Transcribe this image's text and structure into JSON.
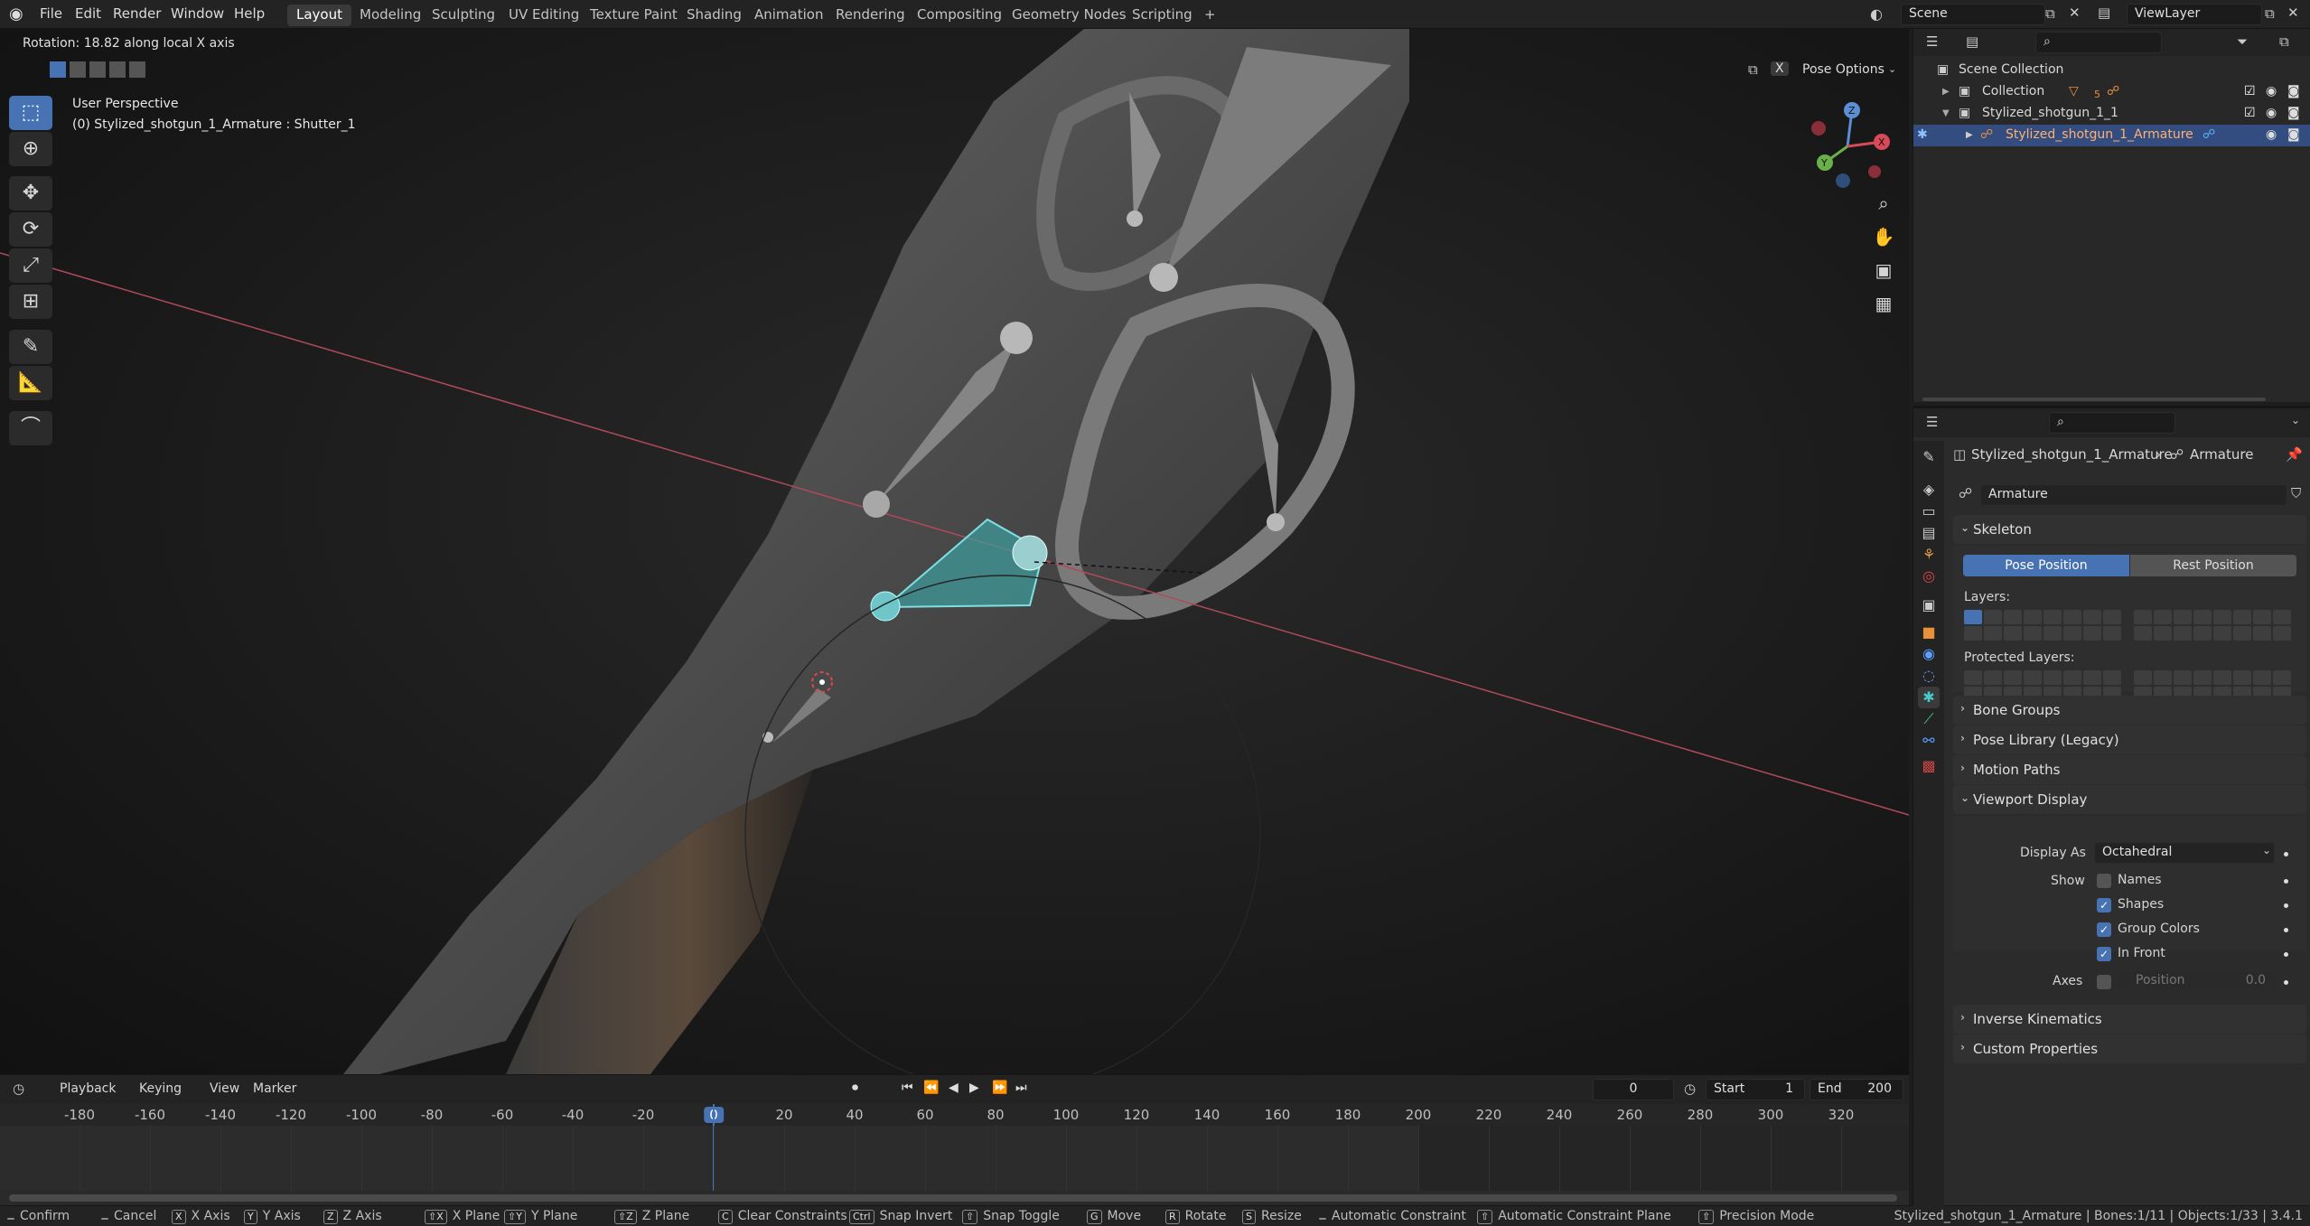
{
  "topbar": {
    "menus": [
      "File",
      "Edit",
      "Render",
      "Window",
      "Help"
    ],
    "workspaces": [
      "Layout",
      "Modeling",
      "Sculpting",
      "UV Editing",
      "Texture Paint",
      "Shading",
      "Animation",
      "Rendering",
      "Compositing",
      "Geometry Nodes",
      "Scripting"
    ],
    "add_tab": "+",
    "scene": "Scene",
    "view_layer": "ViewLayer"
  },
  "viewport": {
    "header_status": "Rotation: 18.82 along local X axis",
    "perspective": "User Perspective",
    "object_info": "(0) Stylized_shotgun_1_Armature : Shutter_1",
    "pose_options": "Pose Options",
    "x_toggle": "X",
    "gizmo": {
      "x": "X",
      "y": "Y",
      "z": "Z"
    }
  },
  "tools": [
    "select-icon",
    "cursor-icon",
    "move-icon",
    "rotate-icon",
    "scale-icon",
    "transform-icon",
    "annotate-icon",
    "measure-icon",
    "bone-envelope-icon"
  ],
  "timeline": {
    "menus": [
      "Playback",
      "Keying",
      "View",
      "Marker"
    ],
    "current_frame": "0",
    "start_label": "Start",
    "start": "1",
    "end_label": "End",
    "end": "200",
    "ticks": [
      "-180",
      "-160",
      "-140",
      "-120",
      "-100",
      "-80",
      "-60",
      "-40",
      "-20",
      "0",
      "20",
      "40",
      "60",
      "80",
      "100",
      "120",
      "140",
      "160",
      "180",
      "200",
      "220",
      "240",
      "260",
      "280",
      "300",
      "320"
    ]
  },
  "status": {
    "items": [
      {
        "k": "",
        "t": "Confirm"
      },
      {
        "k": "",
        "t": "Cancel"
      },
      {
        "k": "X",
        "t": "X Axis"
      },
      {
        "k": "Y",
        "t": "Y Axis"
      },
      {
        "k": "Z",
        "t": "Z Axis"
      },
      {
        "k": "⇧X",
        "t": "X Plane"
      },
      {
        "k": "⇧Y",
        "t": "Y Plane"
      },
      {
        "k": "⇧Z",
        "t": "Z Plane"
      },
      {
        "k": "C",
        "t": "Clear Constraints"
      },
      {
        "k": "Ctrl",
        "t": "Snap Invert"
      },
      {
        "k": "⇧",
        "t": "Snap Toggle"
      },
      {
        "k": "G",
        "t": "Move"
      },
      {
        "k": "R",
        "t": "Rotate"
      },
      {
        "k": "S",
        "t": "Resize"
      },
      {
        "k": "",
        "t": "Automatic Constraint"
      },
      {
        "k": "⇧",
        "t": "Automatic Constraint Plane"
      },
      {
        "k": "⇧",
        "t": "Precision Mode"
      }
    ],
    "info": "Stylized_shotgun_1_Armature | Bones:1/11 | Objects:1/33 | 3.4.1"
  },
  "outliner": {
    "rows": [
      "Scene Collection",
      "Collection",
      "Stylized_shotgun_1_1",
      "Stylized_shotgun_1_Armature"
    ],
    "collection_badge": "5"
  },
  "properties": {
    "breadcrumb_object": "Stylized_shotgun_1_Armature",
    "breadcrumb_data": "Armature",
    "data_name": "Armature",
    "skeleton": "Skeleton",
    "pose_position": "Pose Position",
    "rest_position": "Rest Position",
    "layers": "Layers:",
    "protected_layers": "Protected Layers:",
    "bone_groups": "Bone Groups",
    "pose_library": "Pose Library (Legacy)",
    "motion_paths": "Motion Paths",
    "viewport_display": "Viewport Display",
    "display_as_label": "Display As",
    "display_as": "Octahedral",
    "show_label": "Show",
    "names": "Names",
    "shapes": "Shapes",
    "group_colors": "Group Colors",
    "in_front": "In Front",
    "axes_label": "Axes",
    "position_label": "Position",
    "position_value": "0.0",
    "inverse_kinematics": "Inverse Kinematics",
    "custom_properties": "Custom Properties",
    "names_checked": false,
    "shapes_checked": true,
    "group_colors_checked": true,
    "in_front_checked": true,
    "axes_checked": false
  }
}
